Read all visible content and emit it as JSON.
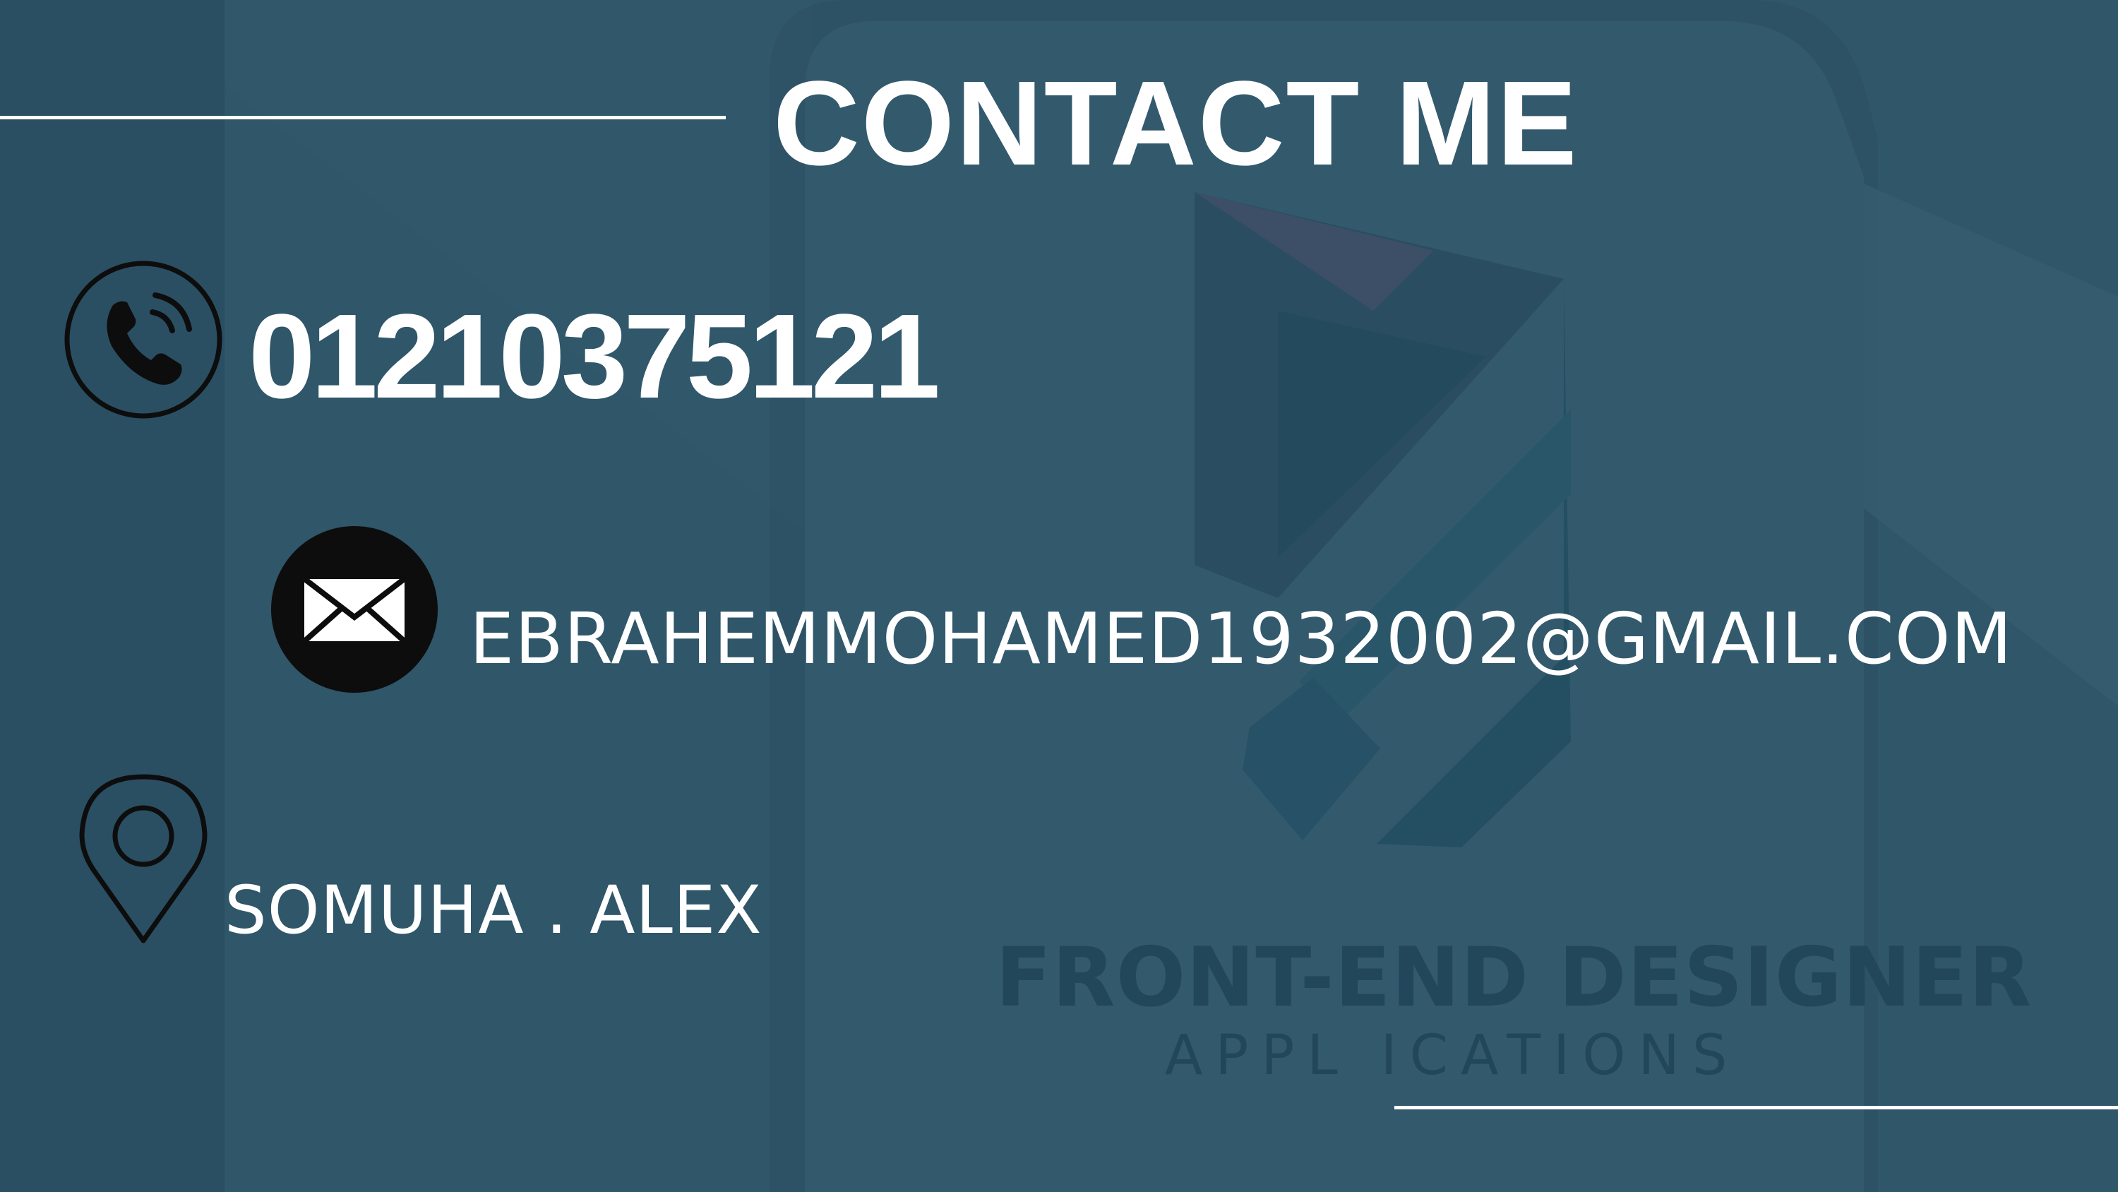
{
  "heading": "CONTACT ME",
  "contact": {
    "phone": "01210375121",
    "email": "EBRAHEMMOHAMED1932002@GMAIL.COM",
    "address": "SOMUHA . ALEX"
  },
  "watermark": {
    "title": "FRONT-END DESIGNER",
    "subtitle": "APPL ICATIONS"
  },
  "icons": {
    "phone": "phone-ringing-icon",
    "email": "envelope-icon",
    "location": "map-pin-icon",
    "logo": "shield-logo-icon"
  },
  "colors": {
    "background": "#2e5468",
    "text": "#ffffff",
    "icon": "#0d0d0d"
  }
}
